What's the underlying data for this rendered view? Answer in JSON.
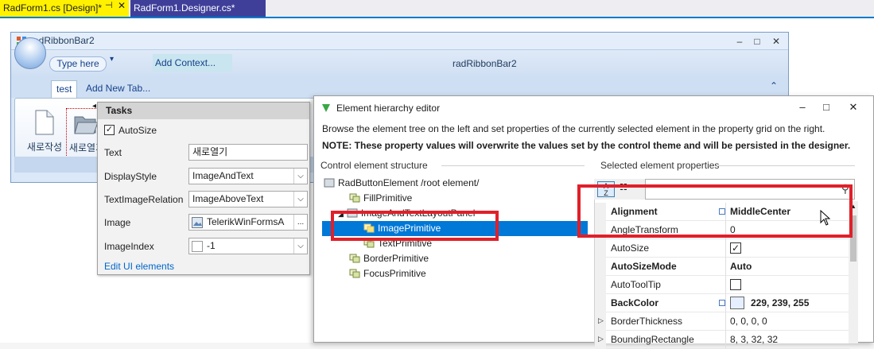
{
  "vs": {
    "tabs": [
      {
        "label": "RadForm1.cs [Design]*"
      },
      {
        "label": "RadForm1.Designer.cs*"
      }
    ]
  },
  "form": {
    "title": "radRibbonBar2",
    "caption": "radRibbonBar2",
    "qat_label": "Type here",
    "add_context": "Add Context...",
    "tab_selected": "test",
    "tab_add": "Add New Tab...",
    "buttons": [
      {
        "label": "새로작성"
      },
      {
        "label": "새로열기"
      }
    ]
  },
  "tasks": {
    "title": "Tasks",
    "autosize_label": "AutoSize",
    "fields": [
      {
        "label": "Text",
        "value": "새로열기"
      },
      {
        "label": "DisplayStyle",
        "value": "ImageAndText"
      },
      {
        "label": "TextImageRelation",
        "value": "ImageAboveText"
      },
      {
        "label": "Image",
        "value": "TelerikWinFormsA"
      },
      {
        "label": "ImageIndex",
        "value": "-1"
      }
    ],
    "ellipsis": "...",
    "edit_link": "Edit UI elements"
  },
  "dialog": {
    "title": "Element hierarchy editor",
    "desc": "Browse the element tree on the left and set properties of the currently selected element in the property grid on the right.",
    "note": "NOTE: These property values will overwrite the values set by the control theme and will be persisted in the designer.",
    "left_section": "Control element structure",
    "right_section": "Selected element properties",
    "tree": [
      {
        "label": "RadButtonElement /root element/"
      },
      {
        "label": "FillPrimitive"
      },
      {
        "label": "ImageAndTextLayoutPanel"
      },
      {
        "label": "ImagePrimitive"
      },
      {
        "label": "TextPrimitive"
      },
      {
        "label": "BorderPrimitive"
      },
      {
        "label": "FocusPrimitive"
      }
    ],
    "properties": [
      {
        "name": "Alignment",
        "value": "MiddleCenter"
      },
      {
        "name": "AngleTransform",
        "value": "0"
      },
      {
        "name": "AutoSize",
        "value": ""
      },
      {
        "name": "AutoSizeMode",
        "value": "Auto"
      },
      {
        "name": "AutoToolTip",
        "value": ""
      },
      {
        "name": "BackColor",
        "value": "229, 239, 255"
      },
      {
        "name": "BorderThickness",
        "value": "0, 0, 0, 0"
      },
      {
        "name": "BoundingRectangle",
        "value": "8, 3, 32, 32"
      }
    ],
    "backcolor_hex": "#e5efff"
  },
  "colors": {
    "highlight": "#e0202a",
    "selection": "#0078d7",
    "vs_accent": "#007acc"
  }
}
